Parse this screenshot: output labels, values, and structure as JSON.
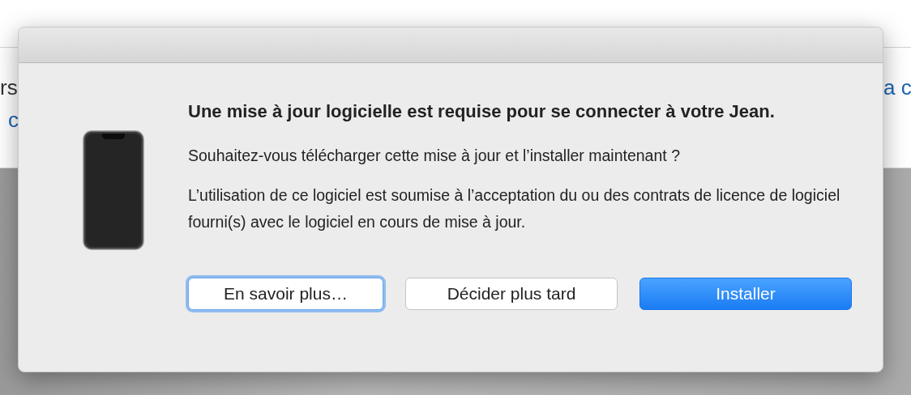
{
  "background": {
    "left_texts": [
      "rs",
      "c"
    ],
    "right_texts": [
      "a c"
    ]
  },
  "dialog": {
    "title": "Une mise à jour logicielle est requise pour se connecter à votre Jean.",
    "paragraphs": [
      "Souhaitez-vous télécharger cette mise à jour et l’installer maintenant ?",
      "L’utilisation de ce logiciel est soumise à l’acceptation du ou des contrats de licence de logiciel fourni(s) avec le logiciel en cours de mise à jour."
    ],
    "buttons": [
      {
        "label": "En savoir plus…",
        "kind": "focused"
      },
      {
        "label": "Décider plus tard",
        "kind": "normal"
      },
      {
        "label": "Installer",
        "kind": "default"
      }
    ]
  }
}
